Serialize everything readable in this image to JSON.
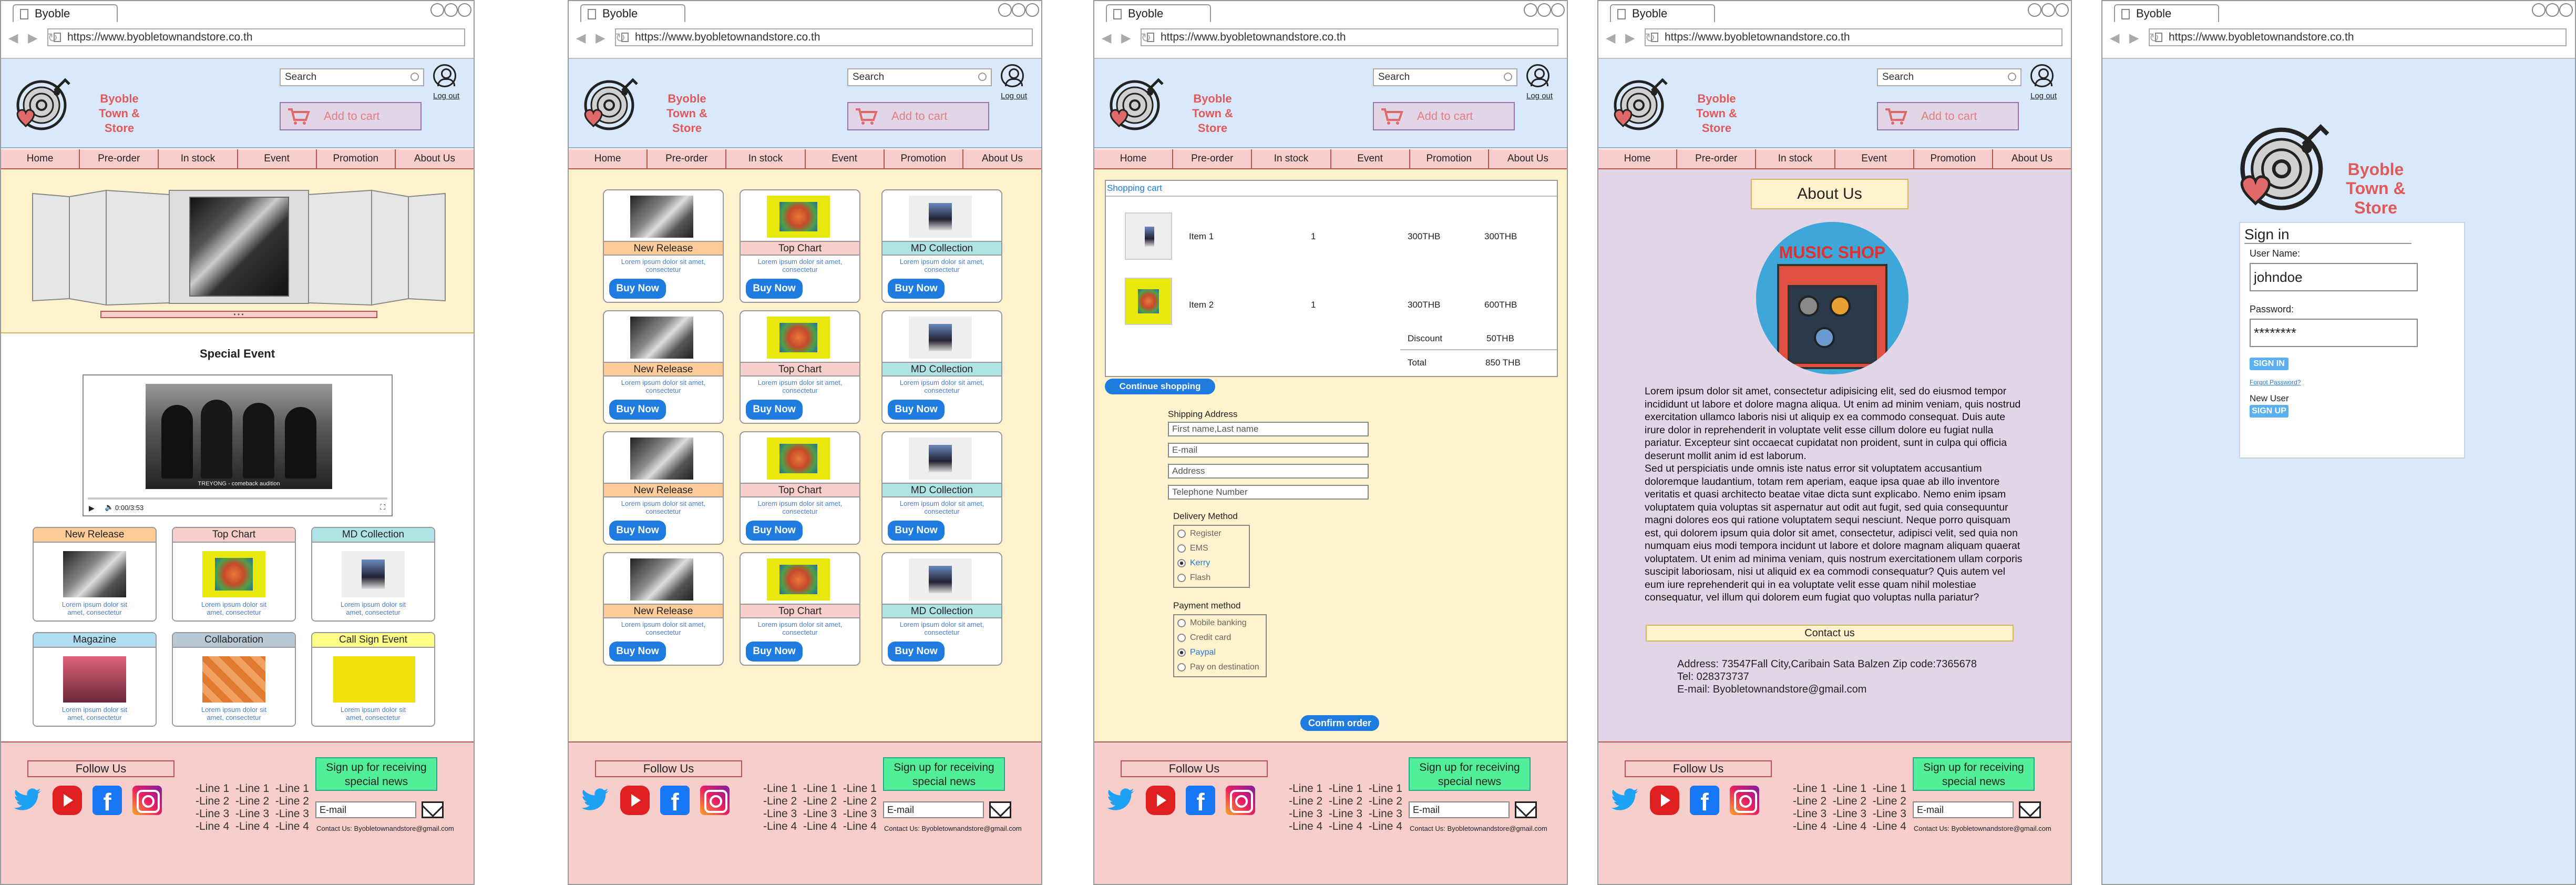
{
  "browser": {
    "tab_title": "Byoble",
    "url": "https://www.byobletownandstore.co.th"
  },
  "header": {
    "brand_line1": "Byoble",
    "brand_line2": "Town & Store",
    "search_placeholder": "Search",
    "login": "Log out",
    "cart": "Add to cart"
  },
  "menu": [
    "Home",
    "Pre-order",
    "In stock",
    "Event",
    "Promotion",
    "About Us"
  ],
  "footer": {
    "follow": "Follow Us",
    "lines": "-Line 1  -Line 1  -Line 1\n-Line 2  -Line 2  -Line 2\n-Line 3  -Line 3  -Line 3\n-Line 4  -Line 4  -Line 4",
    "signup": "Sign up for receiving special news",
    "email": "E-mail",
    "contact": "Contact Us:  Byobletownandstore@gmail.com"
  },
  "lorem_short": "Lorem ipsum dolor sit amet, consectetur",
  "home": {
    "special_event": "Special Event",
    "video_caption": "TREYONG - comeback audition",
    "video_time": "0:00/3:53",
    "categories": [
      {
        "label": "New Release"
      },
      {
        "label": "Top Chart"
      },
      {
        "label": "MD Collection"
      },
      {
        "label": "Magazine"
      },
      {
        "label": "Collaboration"
      },
      {
        "label": "Call Sign Event"
      }
    ]
  },
  "products": {
    "buy": "Buy Now",
    "labels": [
      "New Release",
      "Top Chart",
      "MD Collection"
    ]
  },
  "cart_page": {
    "title": "Shopping  cart",
    "items": [
      {
        "name": "Item 1",
        "qty": "1",
        "price": "300THB",
        "total": "300THB"
      },
      {
        "name": "Item 2",
        "qty": "1",
        "price": "300THB",
        "total": "600THB"
      }
    ],
    "discount_label": "Discount",
    "discount": "50THB",
    "total_label": "Total",
    "total": "850 THB",
    "continue": "Continue shopping",
    "shipping_title": "Shipping Address",
    "fields": [
      "First name,Last name",
      "E-mail",
      "Address",
      "Telephone Number"
    ],
    "delivery_title": "Delivery Method",
    "delivery": [
      "Register",
      "EMS",
      "Kerry",
      "Flash"
    ],
    "payment_title": "Payment method",
    "payment": [
      "Mobile banking",
      "Credit card",
      "Paypal",
      "Pay on destination"
    ],
    "confirm": "Confirm order"
  },
  "about": {
    "title": "About Us",
    "shop_sign": "MUSIC SHOP",
    "paragraph": "Lorem ipsum dolor sit amet, consectetur adipisicing elit, sed do eiusmod tempor incididunt ut labore et dolore magna aliqua. Ut enim ad minim veniam, quis nostrud exercitation ullamco laboris nisi ut aliquip ex ea commodo consequat. Duis aute irure dolor in reprehenderit in voluptate velit esse cillum dolore eu fugiat nulla pariatur. Excepteur sint occaecat cupidatat non proident, sunt in culpa qui officia deserunt mollit anim id est laborum.\nSed ut perspiciatis unde omnis iste natus error sit voluptatem accusantium doloremque laudantium, totam rem aperiam, eaque ipsa quae ab illo inventore veritatis et quasi architecto beatae vitae dicta sunt explicabo. Nemo enim ipsam voluptatem quia voluptas sit aspernatur aut odit aut fugit, sed quia consequuntur magni dolores eos qui ratione voluptatem sequi nesciunt. Neque porro quisquam est, qui dolorem ipsum quia dolor sit amet, consectetur, adipisci velit, sed quia non numquam eius modi tempora incidunt ut labore et dolore magnam aliquam quaerat voluptatem. Ut enim ad minima veniam, quis nostrum exercitationem ullam corporis suscipit laboriosam, nisi ut aliquid ex ea commodi consequatur? Quis autem vel eum iure reprehenderit qui in ea voluptate velit esse quam nihil molestiae consequatur, vel illum qui dolorem eum fugiat quo voluptas nulla pariatur?",
    "contact_title": "Contact us",
    "address": "Address: 73547Fall  City,Caribain Sata Balzen Zip code:7365678",
    "tel": "Tel: 028373737",
    "email": "E-mail: Byobletownandstore@gmail.com"
  },
  "signin": {
    "brand_line1": "Byoble",
    "brand_line2": "Town & Store",
    "title": "Sign in",
    "user_label": "User Name:",
    "user_value": "johndoe",
    "pass_label": "Password:",
    "pass_value": "********",
    "button": "SIGN IN",
    "forgot": "Forgot Password?",
    "new_user": "New User",
    "signup": "SIGN UP"
  },
  "colors": {
    "header_bg": "#dae8fc",
    "menu_bg": "#f8cecc",
    "home_banner_bg": "#fff2cc",
    "home_body_bg": "#e1d5e7",
    "button_blue": "#1e7be0",
    "signup_green": "#52ef99",
    "brand_red": "#e05a5a"
  }
}
